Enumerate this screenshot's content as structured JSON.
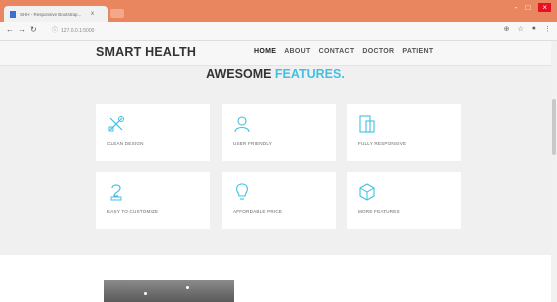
{
  "browser": {
    "tab_title": "SHH - Responsive Bootstrap...",
    "tab_close": "x",
    "url": "127.0.0.1:5000",
    "controls": [
      "-",
      "□",
      "×"
    ]
  },
  "site": {
    "brand": "SMART HEALTH",
    "menu": [
      "HOME",
      "ABOUT",
      "CONTACT",
      "DOCTOR",
      "PATIENT"
    ]
  },
  "features": {
    "title_main": "AWESOME ",
    "title_accent": "FEATURES.",
    "accent_color": "#42c0e3",
    "items": [
      {
        "label": "CLEAN DESIGN",
        "icon": "tools-icon"
      },
      {
        "label": "USER FRIENDLY",
        "icon": "user-icon"
      },
      {
        "label": "FULLY RESPONSIVE",
        "icon": "devices-icon"
      },
      {
        "label": "EASY TO CUSTOMIZE",
        "icon": "customize-icon"
      },
      {
        "label": "AFFORDABLE PRICE",
        "icon": "lightbulb-icon"
      },
      {
        "label": "MORE FEATURES",
        "icon": "cube-icon"
      }
    ]
  }
}
